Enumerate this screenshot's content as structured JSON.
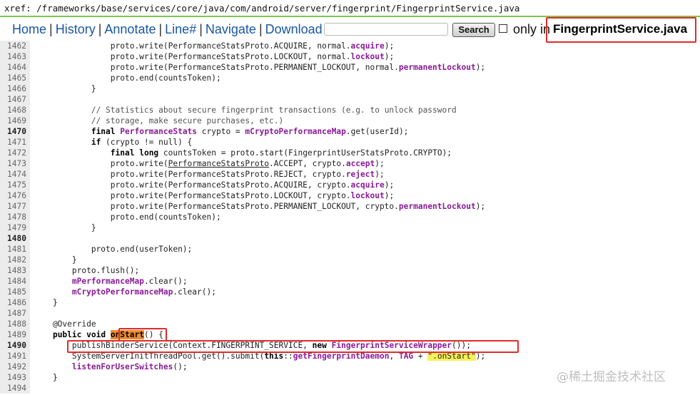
{
  "xref": "xref: /frameworks/base/services/core/java/com/android/server/fingerprint/FingerprintService.java",
  "nav": {
    "home": "Home",
    "history": "History",
    "annotate": "Annotate",
    "line": "Line#",
    "navigate": "Navigate",
    "download": "Download",
    "search_button": "Search",
    "search_placeholder": "",
    "only_in": "only in",
    "file_name": "FingerprintService.java"
  },
  "watermark": "@稀土掘金技术社区",
  "colors": {
    "link": "#1a56a6",
    "keyword_purple": "#8b1a9a",
    "highlight_red": "#e32a2a",
    "nav_bar_green": "#7ec452"
  },
  "lines": [
    {
      "n": "1462",
      "b": false,
      "t": "                proto.write(PerformanceStatsProto.ACQUIRE, normal.<p>acquire</p>);"
    },
    {
      "n": "1463",
      "b": false,
      "t": "                proto.write(PerformanceStatsProto.LOCKOUT, normal.<p>lockout</p>);"
    },
    {
      "n": "1464",
      "b": false,
      "t": "                proto.write(PerformanceStatsProto.PERMANENT_LOCKOUT, normal.<p>permanentLockout</p>);"
    },
    {
      "n": "1465",
      "b": false,
      "t": "                proto.end(countsToken);"
    },
    {
      "n": "1466",
      "b": false,
      "t": "            }"
    },
    {
      "n": "1467",
      "b": false,
      "t": ""
    },
    {
      "n": "1468",
      "b": false,
      "t": "            <c>// Statistics about secure fingerprint transactions (e.g. to unlock password</c>"
    },
    {
      "n": "1469",
      "b": false,
      "t": "            <c>// storage, make secure purchases, etc.)</c>"
    },
    {
      "n": "1470",
      "b": true,
      "t": "            <k>final</k> <p>PerformanceStats</p> crypto = <p>mCryptoPerformanceMap</p>.get(userId);"
    },
    {
      "n": "1471",
      "b": false,
      "t": "            <k>if</k> (crypto != null) {"
    },
    {
      "n": "1472",
      "b": false,
      "t": "                <k>final</k> <k>long</k> countsToken = proto.start(FingerprintUserStatsProto.CRYPTO);"
    },
    {
      "n": "1473",
      "b": false,
      "t": "                proto.write(<u>PerformanceStatsProto</u>.ACCEPT, crypto.<p>accept</p>);"
    },
    {
      "n": "1474",
      "b": false,
      "t": "                proto.write(PerformanceStatsProto.REJECT, crypto.<p>reject</p>);"
    },
    {
      "n": "1475",
      "b": false,
      "t": "                proto.write(PerformanceStatsProto.ACQUIRE, crypto.<p>acquire</p>);"
    },
    {
      "n": "1476",
      "b": false,
      "t": "                proto.write(PerformanceStatsProto.LOCKOUT, crypto.<p>lockout</p>);"
    },
    {
      "n": "1477",
      "b": false,
      "t": "                proto.write(PerformanceStatsProto.PERMANENT_LOCKOUT, crypto.<p>permanentLockout</p>);"
    },
    {
      "n": "1478",
      "b": false,
      "t": "                proto.end(countsToken);"
    },
    {
      "n": "1479",
      "b": false,
      "t": "            }"
    },
    {
      "n": "1480",
      "b": true,
      "t": ""
    },
    {
      "n": "1481",
      "b": false,
      "t": "            proto.end(userToken);"
    },
    {
      "n": "1482",
      "b": false,
      "t": "        }"
    },
    {
      "n": "1483",
      "b": false,
      "t": "        proto.flush();"
    },
    {
      "n": "1484",
      "b": false,
      "t": "        <p>mPerformanceMap</p>.clear();"
    },
    {
      "n": "1485",
      "b": false,
      "t": "        <p>mCryptoPerformanceMap</p>.clear();"
    },
    {
      "n": "1486",
      "b": false,
      "t": "    }"
    },
    {
      "n": "1487",
      "b": false,
      "t": ""
    },
    {
      "n": "1488",
      "b": false,
      "t": "    @Override"
    },
    {
      "n": "1489",
      "b": false,
      "t": "    <k>public</k> <k>void</k> <o>onStart</o>() {"
    },
    {
      "n": "1490",
      "b": true,
      "t": "        publishBinderService(Context.FINGERPRINT_SERVICE, <k>new</k> <p>FingerprintServiceWrapper</p>());"
    },
    {
      "n": "1491",
      "b": false,
      "t": "        SystemServerInitThreadPool.get().submit(<k>this</k>::<p>getFingerprintDaemon</p>, <p>TAG</p> + <y>\".onStart\"</y>);"
    },
    {
      "n": "1492",
      "b": false,
      "t": "        <p>listenForUserSwitches</p>();"
    },
    {
      "n": "1493",
      "b": false,
      "t": "    }"
    },
    {
      "n": "1494",
      "b": false,
      "t": ""
    }
  ]
}
